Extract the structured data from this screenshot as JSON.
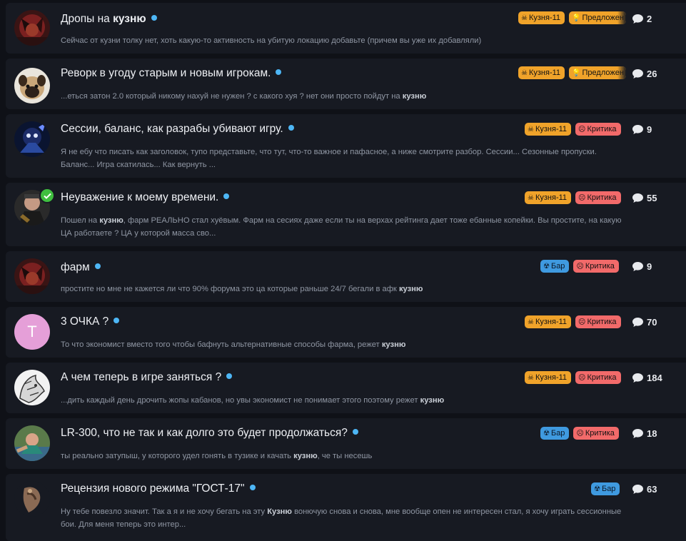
{
  "colors": {
    "background": "#0f1117",
    "card": "#171a22",
    "forge_tag": "#f0a32a",
    "critic_tag": "#f26a6a",
    "bar_tag": "#3f9ae0",
    "unread_dot": "#4db6f5",
    "verified_badge": "#3fbf3f"
  },
  "tags": {
    "forge": "Кузня-11",
    "suggest": "Предложен",
    "critic": "Критика",
    "bar": "Бар"
  },
  "topics": [
    {
      "title_pre": "Дропы на ",
      "title_bold": "кузню",
      "snippet_pre": "Сейчас от кузни толку нет, хоть какую-то активность на убитую локацию добавьте (причем вы уже их добавляли)",
      "snippet_bold": "",
      "snippet_post": "",
      "replies": "2",
      "avatar_letter": ""
    },
    {
      "title_pre": "Реворк в угоду старым и новым игрокам.",
      "title_bold": "",
      "snippet_pre": "...еться затон 2.0 который никому нахуй не нужен ? с какого хуя ? нет они просто пойдут на ",
      "snippet_bold": "кузню",
      "snippet_post": "",
      "replies": "26",
      "avatar_letter": ""
    },
    {
      "title_pre": "Сессии, баланс, как разрабы убивают игру.",
      "title_bold": "",
      "snippet_pre": "Я не ебу что писать как заголовок, тупо представьте, что тут, что-то важное и пафасное, а ниже смотрите разбор. Сессии... Сезонные пропуски. Баланс... Игра скатилась... Как вернуть ...",
      "snippet_bold": "",
      "snippet_post": "",
      "replies": "9",
      "avatar_letter": ""
    },
    {
      "title_pre": "Неуважение к моему времени.",
      "title_bold": "",
      "snippet_pre": "Пошел на ",
      "snippet_bold": "кузню",
      "snippet_post": ", фарм РЕАЛЬНО стал хуёвым. Фарм на сесиях даже если ты на верхах рейтинга дает тоже ебанные копейки. Вы простите, на какую ЦА работаете ? ЦА у которой масса сво...",
      "replies": "55",
      "avatar_letter": ""
    },
    {
      "title_pre": "фарм",
      "title_bold": "",
      "snippet_pre": "простите но мне не кажется ли что 90% форума это ца которые раньше 24/7 бегали в афк ",
      "snippet_bold": "кузню",
      "snippet_post": "",
      "replies": "9",
      "avatar_letter": ""
    },
    {
      "title_pre": "3 ОЧКА ?",
      "title_bold": "",
      "snippet_pre": "То что экономист вместо того чтобы бафнуть альтернативные способы фарма, режет ",
      "snippet_bold": "кузню",
      "snippet_post": "",
      "replies": "70",
      "avatar_letter": "T"
    },
    {
      "title_pre": "А чем теперь в игре заняться ?",
      "title_bold": "",
      "snippet_pre": "...дить каждый день дрочить жопы кабанов, но увы экономист не понимает этого поэтому режет ",
      "snippet_bold": "кузню",
      "snippet_post": "",
      "replies": "184",
      "avatar_letter": ""
    },
    {
      "title_pre": "LR-300, что не так и как долго это будет продолжаться?",
      "title_bold": "",
      "snippet_pre": "ты реально затупыш, у которого удел гонять в тузике и качать ",
      "snippet_bold": "кузню",
      "snippet_post": ", че ты несешь",
      "replies": "18",
      "avatar_letter": ""
    },
    {
      "title_pre": "Рецензия нового режима \"ГОСТ-17\"",
      "title_bold": "",
      "snippet_pre": "Ну тебе повезло значит. Так а я и не хочу бегать на эту ",
      "snippet_bold": "Кузню",
      "snippet_post": " вонючую снова и снова, мне вообще опен не интересен стал, я хочу играть сессионные бои. Для меня теперь это интер...",
      "replies": "63",
      "avatar_letter": ""
    }
  ]
}
